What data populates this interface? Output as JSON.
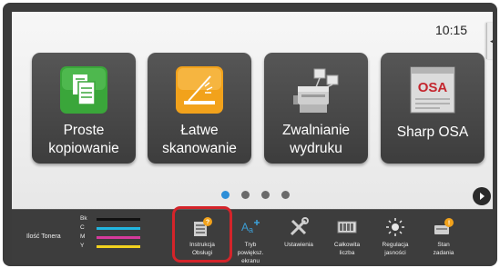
{
  "status": {
    "time": "10:15"
  },
  "tiles": [
    {
      "label_line1": "Proste",
      "label_line2": "kopiowanie",
      "icon": "copy-icon"
    },
    {
      "label_line1": "Łatwe",
      "label_line2": "skanowanie",
      "icon": "scan-icon"
    },
    {
      "label_line1": "Zwalnianie",
      "label_line2": "wydruku",
      "icon": "print-release-icon"
    },
    {
      "label_line1": "Sharp OSA",
      "label_line2": "",
      "icon": "sharp-osa-icon"
    }
  ],
  "pager": {
    "pages": 4,
    "current": 1
  },
  "toner": {
    "label": "Ilość Tonera",
    "levels": [
      {
        "code": "Bk",
        "color": "#111111"
      },
      {
        "code": "C",
        "color": "#22b6e0"
      },
      {
        "code": "M",
        "color": "#d63a9c"
      },
      {
        "code": "Y",
        "color": "#f2d21e"
      }
    ]
  },
  "functions": [
    {
      "line1": "Instrukcja",
      "line2": "Obsługi",
      "icon": "manual-icon"
    },
    {
      "line1": "Tryb",
      "line2": "powiększ.",
      "line3": "ekranu",
      "icon": "zoom-mode-icon"
    },
    {
      "line1": "Ustawienia",
      "line2": "",
      "icon": "settings-tools-icon"
    },
    {
      "line1": "Całkowita",
      "line2": "liczba",
      "icon": "counter-icon"
    },
    {
      "line1": "Regulacja",
      "line2": "jasności",
      "icon": "brightness-icon"
    },
    {
      "line1": "Stan",
      "line2": "zadania",
      "icon": "job-status-icon"
    }
  ],
  "colors": {
    "highlight": "#d4242a",
    "pager_active": "#2d8fd8",
    "copy_tile": "#3aa63a",
    "scan_tile": "#f2a21b"
  }
}
